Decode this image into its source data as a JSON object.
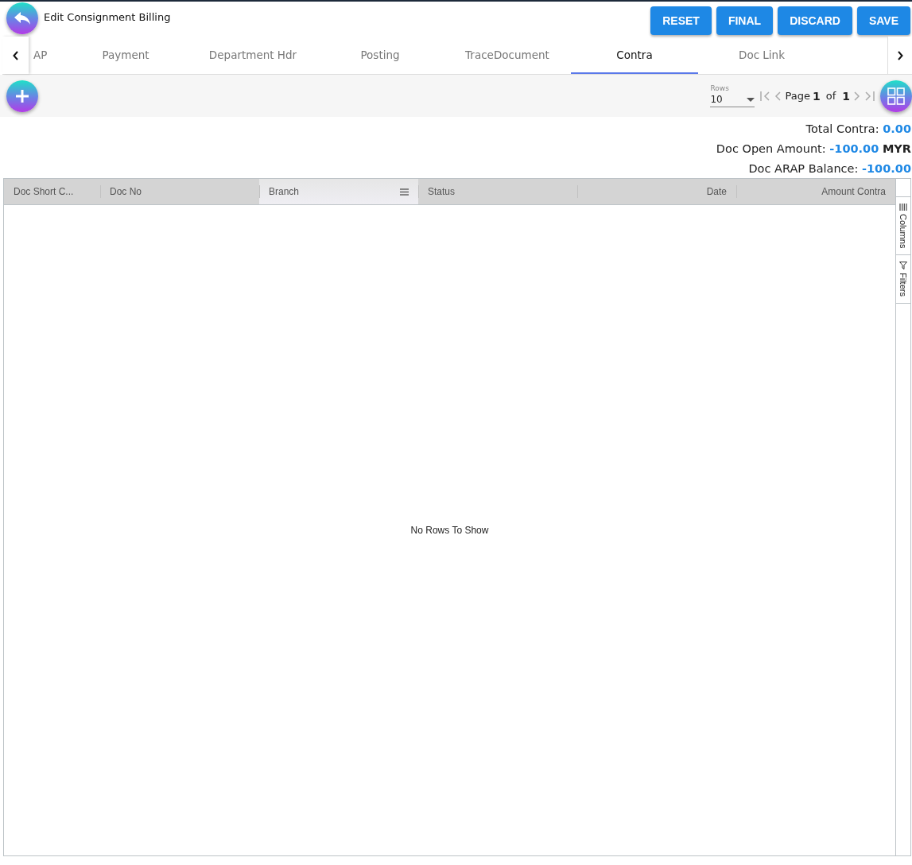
{
  "header": {
    "title": "Edit Consignment Billing",
    "buttons": [
      "RESET",
      "FINAL",
      "DISCARD",
      "SAVE"
    ]
  },
  "tabs": [
    {
      "label": "AP",
      "selected": false
    },
    {
      "label": "Payment",
      "selected": false
    },
    {
      "label": "Department Hdr",
      "selected": false
    },
    {
      "label": "Posting",
      "selected": false
    },
    {
      "label": "TraceDocument",
      "selected": false
    },
    {
      "label": "Contra",
      "selected": true
    },
    {
      "label": "Doc Link",
      "selected": false
    }
  ],
  "pagination": {
    "rows_label": "Rows",
    "rows_value": "10",
    "page_label": "Page",
    "page": "1",
    "of_label": "of",
    "total_pages": "1"
  },
  "summary": [
    {
      "label": "Total Contra:",
      "value": "0.00"
    },
    {
      "label": "Doc Open Amount:",
      "value": "-100.00",
      "currency": "MYR"
    },
    {
      "label": "Doc ARAP Balance:",
      "value": "-100.00"
    }
  ],
  "grid": {
    "columns": [
      {
        "label": "Doc Short C...",
        "kind": "text",
        "highlighted": false
      },
      {
        "label": "Doc No",
        "kind": "text",
        "highlighted": false
      },
      {
        "label": "Branch",
        "kind": "text",
        "highlighted": true
      },
      {
        "label": "Status",
        "kind": "text",
        "highlighted": false
      },
      {
        "label": "Date",
        "kind": "numeric",
        "highlighted": false
      },
      {
        "label": "Amount Contra",
        "kind": "numeric",
        "highlighted": false
      }
    ],
    "empty_message": "No Rows To Show",
    "side_tabs": [
      {
        "kind": "columns",
        "label": "Columns"
      },
      {
        "kind": "filters",
        "label": "Filters"
      }
    ]
  }
}
